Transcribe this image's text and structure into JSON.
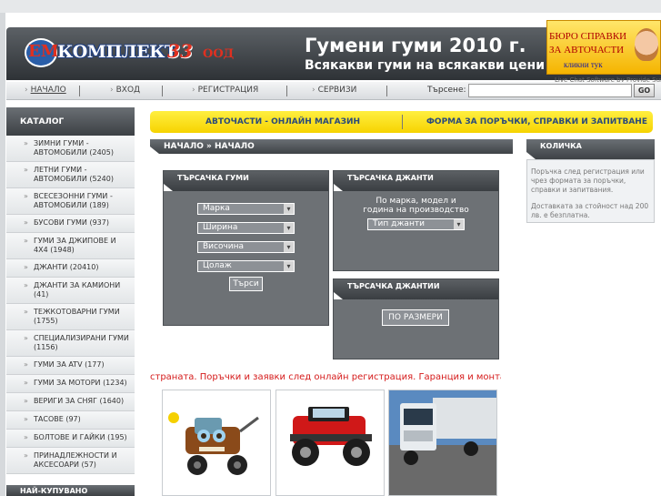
{
  "header": {
    "logo_em": "ЕМ",
    "logo_text": "КОМПЛЕКТ",
    "logo_num": "33",
    "logo_suffix": "ООД",
    "slogan_title": "Гумени гуми 2010 г.",
    "slogan_sub": "Всякакви гуми на всякакви цени",
    "ad": {
      "line1": "БЮРО СПРАВКИ",
      "line2": "ЗА АВТОЧАСТИ",
      "line3": "кликни тук"
    },
    "support_text": "Live Chat Software by Provide Support"
  },
  "nav": {
    "items": [
      "НАЧАЛО",
      "ВХОД",
      "РЕГИСТРАЦИЯ",
      "СЕРВИЗИ"
    ],
    "search_label": "Търсене:",
    "search_value": "",
    "search_button": "GO"
  },
  "sidebar": {
    "title": "КАТАЛОГ",
    "items": [
      "ЗИМНИ ГУМИ - АВТОМОБИЛИ (2405)",
      "ЛЕТНИ ГУМИ - АВТОМОБИЛИ (5240)",
      "ВСЕСЕЗОННИ ГУМИ - АВТОМОБИЛИ (189)",
      "БУСОВИ ГУМИ (937)",
      "ГУМИ ЗА ДЖИПОВЕ И 4X4 (1948)",
      "ДЖАНТИ (20410)",
      "ДЖАНТИ ЗА КАМИОНИ (41)",
      "ТЕЖКОТОВАРНИ ГУМИ (1755)",
      "СПЕЦИАЛИЗИРАНИ ГУМИ (1156)",
      "ГУМИ ЗА ATV (177)",
      "ГУМИ ЗА МОТОРИ (1234)",
      "ВЕРИГИ ЗА СНЯГ (1640)",
      "ТАСОВЕ (97)",
      "БОЛТОВЕ И ГАЙКИ (195)",
      "ПРИНАДЛЕЖНОСТИ И АКСЕСОАРИ (57)"
    ],
    "footer": "НАЙ-КУПУВАНО"
  },
  "yellowbar": {
    "left_link": "АВТОЧАСТИ - ОНЛАЙН МАГАЗИН",
    "right_link": "ФОРМА ЗА ПОРЪЧКИ, СПРАВКИ И ЗАПИТВАНЕ"
  },
  "breadcrumb": "НАЧАЛО » НАЧАЛО",
  "tyre_search": {
    "title": "ТЪРСАЧКА ГУМИ",
    "brand": "Марка",
    "width": "Ширина",
    "height": "Височина",
    "inch": "Цолаж",
    "button": "Търси"
  },
  "rim_search": {
    "title": "ТЪРСАЧКА ДЖАНТИ",
    "text_line1": "По марка, модел и",
    "text_line2": "година на производство",
    "type": "Тип джанти"
  },
  "rim_search2": {
    "title": "ТЪРСАЧКА ДЖАНТИИ",
    "button": "ПО РАЗМЕРИ"
  },
  "cart": {
    "title": "КОЛИЧКА",
    "text1": "Поръчка след регистрация или чрез формата за поръчки, справки и запитвания.",
    "text2": "Доставката за стойност над 200 лв. е безплатна."
  },
  "marquee": "страната. Поръчки и заявки след онлайн регистрация. Гаранция и монтаж в сервиз",
  "colors": {
    "accent_yellow": "#f6d300",
    "dark_panel": "#6d7175",
    "link_blue": "#2a4a7a",
    "marquee_red": "#d51a1a"
  }
}
